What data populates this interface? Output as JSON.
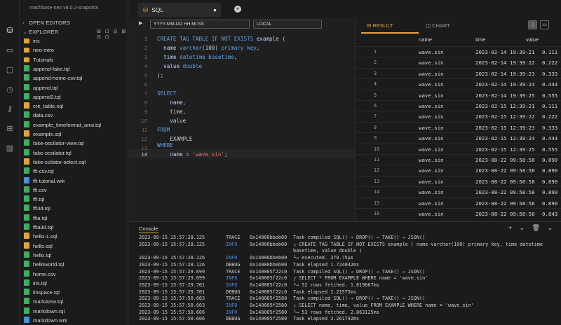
{
  "app": {
    "version": "machbase-neo v8.0.2-snapshot"
  },
  "sidebar": {
    "open_editors": "OPEN EDITORS",
    "explorer": "EXPLORER",
    "tools": "⊞ ⊡ ⊟ ⊠ ⊟ ⊡",
    "files": [
      {
        "name": "iris",
        "type": "folder"
      },
      {
        "name": "neo-intro",
        "type": "folder"
      },
      {
        "name": "Tutorials",
        "type": "folder"
      },
      {
        "name": "append-fake.tql",
        "type": "green"
      },
      {
        "name": "append-home-csv.tql",
        "type": "green"
      },
      {
        "name": "append.tql",
        "type": "green"
      },
      {
        "name": "append2.tql",
        "type": "green"
      },
      {
        "name": "cre_table.sql",
        "type": "yellow"
      },
      {
        "name": "data.csv",
        "type": "green"
      },
      {
        "name": "example_timeformat_ansi.tql",
        "type": "green"
      },
      {
        "name": "example.sql",
        "type": "yellow"
      },
      {
        "name": "fake-oscilator-view.tql",
        "type": "green"
      },
      {
        "name": "fake-ocsilator.tql",
        "type": "green"
      },
      {
        "name": "fake-scilator-select.sql",
        "type": "yellow"
      },
      {
        "name": "fft-csv.tql",
        "type": "green"
      },
      {
        "name": "fft-tutorial.wrk",
        "type": "blue"
      },
      {
        "name": "fft.csv",
        "type": "green"
      },
      {
        "name": "fft.tql",
        "type": "green"
      },
      {
        "name": "fft3d.tql",
        "type": "green"
      },
      {
        "name": "ffta.tql",
        "type": "green"
      },
      {
        "name": "ffta3d.tql",
        "type": "green"
      },
      {
        "name": "hello-1.sql",
        "type": "yellow"
      },
      {
        "name": "hello.sql",
        "type": "yellow"
      },
      {
        "name": "hello.tql",
        "type": "green"
      },
      {
        "name": "helloworld.tql",
        "type": "green"
      },
      {
        "name": "home.csv",
        "type": "green"
      },
      {
        "name": "iris.tql",
        "type": "green"
      },
      {
        "name": "linspace.tql",
        "type": "green"
      },
      {
        "name": "markArea.tql",
        "type": "green"
      },
      {
        "name": "markdown.tql",
        "type": "green"
      },
      {
        "name": "markdown.wrk",
        "type": "blue"
      }
    ]
  },
  "editor": {
    "tab_label": "SQL",
    "time_format": "YYYY-MM-DD HH:MI:SS",
    "timezone": "LOCAL"
  },
  "results": {
    "tab_result": "RESULT",
    "tab_chart": "CHART",
    "columns": [
      "name",
      "time",
      "value"
    ],
    "rows": [
      [
        "1",
        "wave.sin",
        "2023-02-14 19:39:21",
        "0.111"
      ],
      [
        "2",
        "wave.sin",
        "2023-02-14 19:39:22",
        "0.222"
      ],
      [
        "3",
        "wave.sin",
        "2023-02-14 19:39:23",
        "0.333"
      ],
      [
        "4",
        "wave.sin",
        "2023-02-14 19:39:24",
        "0.444"
      ],
      [
        "5",
        "wave.sin",
        "2023-02-14 19:39:25",
        "0.555"
      ],
      [
        "6",
        "wave.sin",
        "2023-02-15 12:39:21",
        "0.111"
      ],
      [
        "7",
        "wave.sin",
        "2023-02-15 12:39:22",
        "0.222"
      ],
      [
        "8",
        "wave.sin",
        "2023-02-15 12:39:23",
        "0.333"
      ],
      [
        "9",
        "wave.sin",
        "2023-02-15 12:39:24",
        "0.444"
      ],
      [
        "10",
        "wave.sin",
        "2023-02-15 12:39:25",
        "0.555"
      ],
      [
        "11",
        "wave.sin",
        "2023-08-22 09:58:58",
        "0.890"
      ],
      [
        "12",
        "wave.sin",
        "2023-08-22 09:58:58",
        "0.890"
      ],
      [
        "13",
        "wave.sin",
        "2023-08-22 09:58:58",
        "0.890"
      ],
      [
        "14",
        "wave.sin",
        "2023-08-22 09:58:58",
        "0.890"
      ],
      [
        "15",
        "wave.sin",
        "2023-08-22 09:58:58",
        "0.890"
      ],
      [
        "16",
        "wave.sin",
        "2023-08-22 09:58:58",
        "0.843"
      ]
    ]
  },
  "console": {
    "title": "Console",
    "tools": "+ ⌄ 🗑 ⌄",
    "lines": [
      {
        "ts": "2023-09-15 15:57:28.125",
        "lv": "TRACE",
        "id": "0x14000bbeb00",
        "msg": "Task compiled SQL() → DROP() → TAKE() → JSON()"
      },
      {
        "ts": "2023-09-15 15:57:28.125",
        "lv": "INFO",
        "id": "0x14000bbeb00",
        "msg": "┌ CREATE TAG TABLE IF NOT EXISTS example ( name varchar(100) primary key, time datetime"
      },
      {
        "ts": "",
        "lv": "",
        "id": "",
        "msg": "basetime, value double )"
      },
      {
        "ts": "2023-09-15 15:57:28.126",
        "lv": "INFO",
        "id": "0x14000bbeb00",
        "msg": "└→ executed. 370.75µs"
      },
      {
        "ts": "2023-09-15 15:57:28.126",
        "lv": "DEBUG",
        "id": "0x14000bbeb00",
        "msg": "Task elapsed 1.724042ms"
      },
      {
        "ts": "2023-09-15 15:57:29.699",
        "lv": "TRACE",
        "id": "0x140005f22c0",
        "msg": "Task compiled SQL() → DROP() → TAKE() → JSON()"
      },
      {
        "ts": "2023-09-15 15:57:29.699",
        "lv": "INFO",
        "id": "0x140005f22c0",
        "msg": "┌ SELECT * FROM EXAMPLE WHERE name = 'wave.sin'"
      },
      {
        "ts": "2023-09-15 15:57:29.701",
        "lv": "INFO",
        "id": "0x140005f22c0",
        "msg": "└→ 52 rows fetched. 1.819667ms"
      },
      {
        "ts": "2023-09-15 15:57:29.701",
        "lv": "DEBUG",
        "id": "0x140005f22c0",
        "msg": "Task elapsed 2.21575ms"
      },
      {
        "ts": "2023-09-15 15:57:50.603",
        "lv": "TRACE",
        "id": "0x140005f2580",
        "msg": "Task compiled SQL() → DROP() → TAKE() → JSON()"
      },
      {
        "ts": "2023-09-15 15:57:50.603",
        "lv": "INFO",
        "id": "0x140005f2580",
        "msg": "┌ SELECT name, time, value FROM EXAMPLE WHERE name = 'wave.sin'"
      },
      {
        "ts": "2023-09-15 15:57:50.606",
        "lv": "INFO",
        "id": "0x140005f2580",
        "msg": "└→ 53 rows fetched. 2.863125ms"
      },
      {
        "ts": "2023-09-15 15:57:50.606",
        "lv": "DEBUG",
        "id": "0x140005f2580",
        "msg": "Task elapsed 3.261792ms"
      }
    ]
  }
}
